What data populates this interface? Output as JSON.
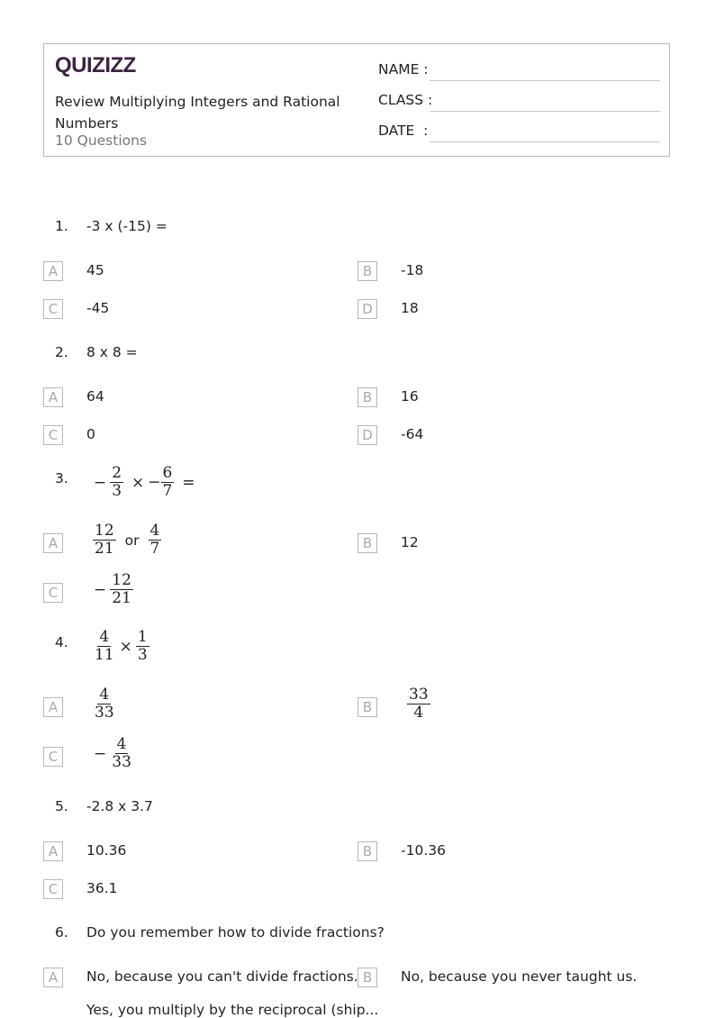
{
  "header": {
    "logo": "QUIZIZZ",
    "title": "Review Multiplying Integers and Rational Numbers",
    "count": "10 Questions",
    "fields": [
      {
        "label": "NAME :"
      },
      {
        "label": "CLASS :"
      },
      {
        "label": "DATE  :"
      }
    ]
  },
  "questions": [
    {
      "number": "1.",
      "text": "-3 x (-15) =",
      "options": [
        {
          "letter": "A",
          "text": "45"
        },
        {
          "letter": "B",
          "text": "-18"
        },
        {
          "letter": "C",
          "text": "-45"
        },
        {
          "letter": "D",
          "text": "18"
        }
      ]
    },
    {
      "number": "2.",
      "text": "8 x 8 =",
      "options": [
        {
          "letter": "A",
          "text": "64"
        },
        {
          "letter": "B",
          "text": "16"
        },
        {
          "letter": "C",
          "text": "0"
        },
        {
          "letter": "D",
          "text": "-64"
        }
      ]
    },
    {
      "number": "3.",
      "math": {
        "neg": "−",
        "f1": {
          "num": "2",
          "den": "3"
        },
        "times": "×",
        "f2": {
          "num": "6",
          "den": "7"
        },
        "eq": "="
      },
      "options": [
        {
          "letter": "A",
          "f1": {
            "num": "12",
            "den": "21"
          },
          "or": "or",
          "f2": {
            "num": "4",
            "den": "7"
          }
        },
        {
          "letter": "B",
          "text": "12"
        },
        {
          "letter": "C",
          "neg": "−",
          "f1": {
            "num": "12",
            "den": "21"
          }
        }
      ]
    },
    {
      "number": "4.",
      "math": {
        "f1": {
          "num": "4",
          "den": "11"
        },
        "times": "×",
        "f2": {
          "num": "1",
          "den": "3"
        }
      },
      "options": [
        {
          "letter": "A",
          "f1": {
            "num": "4",
            "den": "33"
          }
        },
        {
          "letter": "B",
          "f1": {
            "num": "33",
            "den": "4"
          }
        },
        {
          "letter": "C",
          "neg": "−",
          "f1": {
            "num": "4",
            "den": "33"
          }
        }
      ]
    },
    {
      "number": "5.",
      "text": "-2.8 x 3.7",
      "options": [
        {
          "letter": "A",
          "text": "10.36"
        },
        {
          "letter": "B",
          "text": "-10.36"
        },
        {
          "letter": "C",
          "text": "36.1"
        }
      ]
    },
    {
      "number": "6.",
      "text": "Do you remember how to divide fractions?",
      "options": [
        {
          "letter": "A",
          "text": "No, because you can't divide fractions."
        },
        {
          "letter": "B",
          "text": "No, because you never taught us."
        }
      ],
      "partial_option_text": "Yes, you multiply by the reciprocal (ship..."
    }
  ]
}
